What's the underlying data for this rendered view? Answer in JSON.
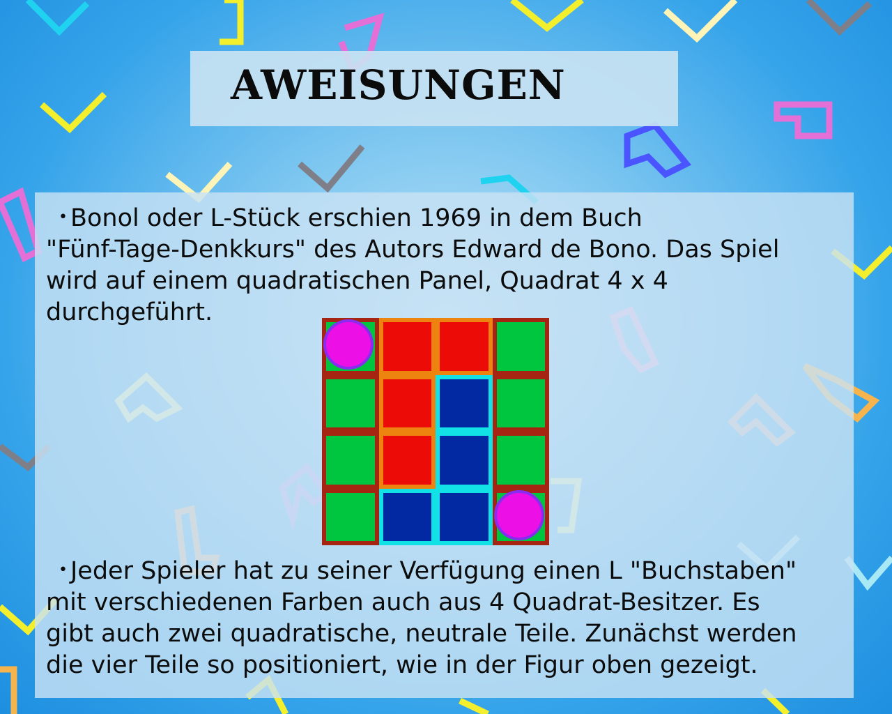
{
  "title": "AWEISUNGEN",
  "paragraph_1": "Bonol oder L-Stück erschien 1969 in dem Buch\n\"Fünf-Tage-Denkkurs\" des Autors Edward de Bono. Das Spiel\nwird auf einem quadratischen Panel, Quadrat 4 x 4\ndurchgeführt.",
  "paragraph_2": "Jeder Spieler hat zu seiner Verfügung einen L \"Buchstaben\"\nmit verschiedenen Farben auch aus 4 Quadrat-Besitzer. Es\ngibt auch zwei quadratische, neutrale Teile. Zunächst werden\ndie vier Teile so positioniert, wie in der Figur oben gezeigt.",
  "bullet": "•",
  "board": {
    "size": 4,
    "cells": [
      [
        "green",
        "red",
        "red",
        "green"
      ],
      [
        "green",
        "red",
        "blue",
        "green"
      ],
      [
        "green",
        "red",
        "blue",
        "green"
      ],
      [
        "green",
        "blue",
        "blue",
        "green"
      ]
    ],
    "neutral_pieces": [
      {
        "row": 0,
        "col": 0
      },
      {
        "row": 3,
        "col": 3
      }
    ]
  },
  "colors": {
    "background": "#36a4ea",
    "green_square": "#00c63f",
    "red_L": "#ec0b06",
    "blue_L": "#0228a2",
    "neutral_piece": "#ec0fe6"
  }
}
